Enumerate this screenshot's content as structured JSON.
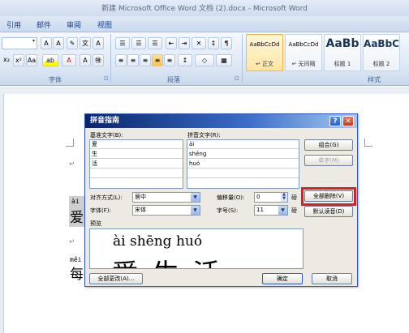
{
  "window": {
    "title": "新建 Microsoft Office Word 文档 (2).docx - Microsoft Word"
  },
  "tabs": [
    {
      "label": "引用"
    },
    {
      "label": "邮件"
    },
    {
      "label": "审阅"
    },
    {
      "label": "视图"
    }
  ],
  "ribbon": {
    "font_group_label": "字体",
    "paragraph_group_label": "段落",
    "styles_group_label": "样式",
    "launcher_glyph": "⊡",
    "styles": [
      {
        "sample": "AaBbCcDd",
        "name": "↵ 正文"
      },
      {
        "sample": "AaBbCcDd",
        "name": "↵ 无间隔"
      },
      {
        "sample": "AaBb",
        "name": "标题 1"
      },
      {
        "sample": "AaBbC",
        "name": "标题 2"
      }
    ]
  },
  "document": {
    "para_mark": "↵",
    "line1_ruby": "ài",
    "line1_char": "爱",
    "line2_ruby": "měi",
    "line2_char": "每"
  },
  "dialog": {
    "title": "拼音指南",
    "help_glyph": "?",
    "close_glyph": "✕",
    "base_text_label": "基准文字(B):",
    "ruby_text_label": "拼音文字(R):",
    "rows": [
      {
        "base": "爱",
        "ruby": "ài"
      },
      {
        "base": "生",
        "ruby": "shēng"
      },
      {
        "base": "活",
        "ruby": "huó"
      },
      {
        "base": "",
        "ruby": ""
      },
      {
        "base": "",
        "ruby": ""
      }
    ],
    "buttons": {
      "group": "组合(G)",
      "mono": "单字(M)",
      "clear_all": "全部删除(V)",
      "default_reading": "默认读音(D)",
      "change_all": "全部更改(A)...",
      "ok": "确定",
      "cancel": "取消"
    },
    "alignment_label": "对齐方式(L):",
    "alignment_value": "居中",
    "offset_label": "偏移量(O):",
    "offset_value": "0",
    "offset_unit": "磅",
    "font_label": "字体(F):",
    "font_value": "宋体",
    "size_label": "字号(S):",
    "size_value": "11",
    "size_unit": "磅",
    "preview_label": "预览",
    "preview_ruby": "ài shēng huó",
    "preview_chars": "爱生活",
    "dropdown_glyph": "▼",
    "spin_up": "▲",
    "spin_down": "▼"
  }
}
